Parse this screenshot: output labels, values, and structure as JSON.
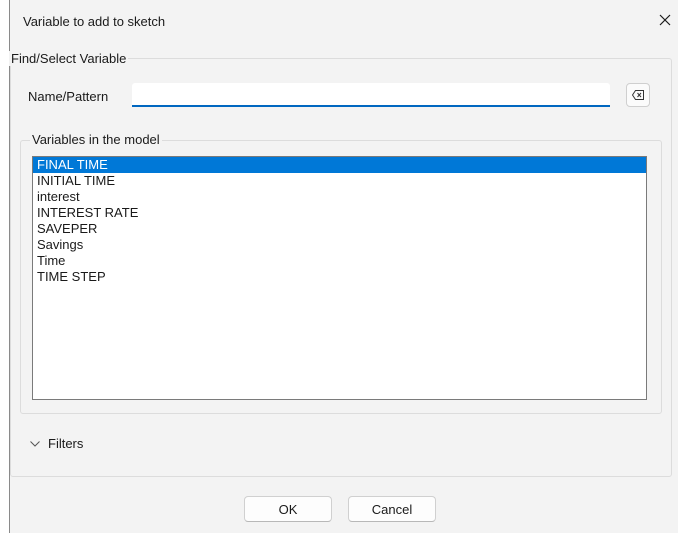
{
  "window": {
    "title": "Variable to add to sketch"
  },
  "find_group": {
    "title": "Find/Select Variable",
    "name_pattern_label": "Name/Pattern",
    "name_pattern_value": "",
    "clear_icon": "backspace-icon"
  },
  "variables_group": {
    "title": "Variables in the model",
    "items": [
      "FINAL TIME",
      "INITIAL TIME",
      "interest",
      "INTEREST RATE",
      "SAVEPER",
      "Savings",
      "Time",
      "TIME STEP"
    ],
    "selected_index": 0
  },
  "filters": {
    "label": "Filters",
    "icon": "chevron-down-icon"
  },
  "buttons": {
    "ok": "OK",
    "cancel": "Cancel"
  },
  "colors": {
    "selection": "#0078d7",
    "accent_underline": "#0067c0",
    "dialog_bg": "#f3f3f3"
  }
}
